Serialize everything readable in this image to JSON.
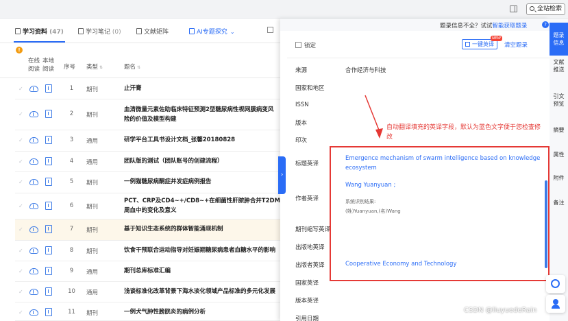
{
  "topbar": {
    "global_search": "全站检索"
  },
  "tabs": [
    {
      "label": "学习资料",
      "count": "(47)"
    },
    {
      "label": "学习笔记",
      "count": "(0)"
    },
    {
      "label": "文献矩阵",
      "count": ""
    },
    {
      "label": "AI专题探究",
      "count": ""
    }
  ],
  "table": {
    "headers": {
      "online_read": "在线\n阅读",
      "local_read": "本地\n阅读",
      "index": "序号",
      "type": "类型",
      "title": "题名"
    },
    "rows": [
      {
        "num": "1",
        "type": "期刊",
        "title": "止汗膏",
        "highlight": false
      },
      {
        "num": "2",
        "type": "期刊",
        "title": "血清微量元素佐助临床特征预测2型糖尿病性视网膜病变风",
        "title2": "险的价值及模型构建",
        "highlight": false
      },
      {
        "num": "3",
        "type": "通用",
        "title": "研学平台工具书设计文档_张馨20180828",
        "highlight": false
      },
      {
        "num": "4",
        "type": "通用",
        "title": "团队版的测试（团队账号的创建流程）",
        "highlight": false
      },
      {
        "num": "5",
        "type": "期刊",
        "title": "一例猫糖尿病酮症并发症病例报告",
        "highlight": false
      },
      {
        "num": "6",
        "type": "期刊",
        "title": "PCT、CRP及CD4~+/CD8~+在细菌性肝脓肿合并T2DM患者",
        "title2": "周血中的变化及意义",
        "highlight": false
      },
      {
        "num": "7",
        "type": "期刊",
        "title": "基于知识生态系统的群体智能涌现机制",
        "highlight": true
      },
      {
        "num": "8",
        "type": "期刊",
        "title": "饮食干预联合运动指导对妊娠期糖尿病患者血糖水平的影响",
        "highlight": false
      },
      {
        "num": "9",
        "type": "通用",
        "title": "期刊总库标准汇编",
        "highlight": false
      },
      {
        "num": "10",
        "type": "通用",
        "title": "浅谈标准化改革背景下海水淡化领域产品标准的多元化发展",
        "highlight": false
      },
      {
        "num": "11",
        "type": "期刊",
        "title": "一例犬气肿性膀胱炎的病例分析",
        "highlight": false
      }
    ]
  },
  "detail": {
    "notice": "题录信息不全？试试",
    "notice_link": "智能获取题录",
    "lock_label": "锁定",
    "translate_button": "一键英译",
    "new_badge": "NEW",
    "clear_button": "清空题录",
    "fields": {
      "source": {
        "label": "来源",
        "value": "合作经济与科技"
      },
      "region": {
        "label": "国家和地区",
        "value": ""
      },
      "issn": {
        "label": "ISSN",
        "value": ""
      },
      "edition": {
        "label": "版本",
        "value": ""
      },
      "printing": {
        "label": "印次",
        "value": ""
      },
      "title_en": {
        "label": "标题英译",
        "value": "Emergence mechanism of swarm intelligence based on knowledge ecosystem"
      },
      "author_en": {
        "label": "作者英译",
        "value": "Wang Yuanyuan ;",
        "sub1": "系统识别结果:",
        "sub2": "(姓)Yuanyuan,(名)Wang"
      },
      "journal_abbr": {
        "label": "期刊缩写英译",
        "value": ""
      },
      "pub_place": {
        "label": "出版地英译",
        "value": ""
      },
      "publisher": {
        "label": "出版者英译",
        "value": "Cooperative Economy and Technology"
      },
      "country_en": {
        "label": "国家英译",
        "value": ""
      },
      "edition_en": {
        "label": "版本英译",
        "value": ""
      },
      "cite_date": {
        "label": "引用日期",
        "value": ""
      }
    },
    "annotation": "自动翻译填充的英译字段，默认为蓝色文字便于您检查修改"
  },
  "vnav": [
    "题录\n信息",
    "文献\n推送",
    "引文\n预览",
    "摘要",
    "属性",
    "附件",
    "备注"
  ],
  "watermark": "CSDN @liuyuedeRain"
}
